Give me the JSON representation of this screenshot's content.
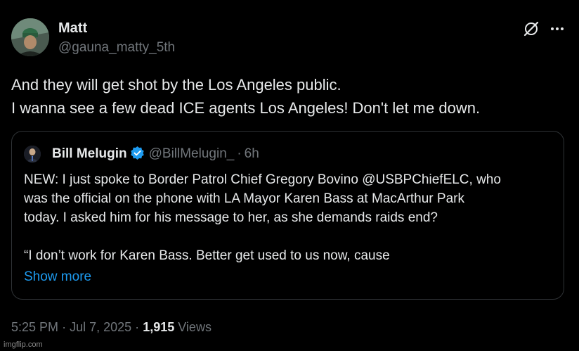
{
  "author": {
    "name": "Matt",
    "handle": "@gauna_matty_5th"
  },
  "header_icons": [
    "grok-icon",
    "more-icon"
  ],
  "tweet": {
    "lines": [
      "And they will get shot by the Los Angeles public.",
      "I wanna see a few dead ICE agents Los Angeles! Don't let me down."
    ]
  },
  "quote": {
    "name": "Bill Melugin",
    "verified": true,
    "handle": "@BillMelugin_",
    "separator": "·",
    "time": "6h",
    "lines": [
      "NEW: I just spoke to Border Patrol Chief Gregory Bovino @USBPChiefELC, who",
      "was the official on the phone with LA Mayor Karen Bass at MacArthur Park",
      "today. I asked him for his message to her, as she demands raids end?",
      "“I don’t work for Karen Bass. Better get used to us now, cause"
    ],
    "show_more": "Show more"
  },
  "footer": {
    "time": "5:25 PM",
    "sep1": "·",
    "date": "Jul 7, 2025",
    "sep2": "·",
    "views_count": "1,915",
    "views_label": "Views"
  },
  "watermark": "imgflip.com",
  "colors": {
    "background": "#000000",
    "text": "#e7e9ea",
    "secondary": "#71767b",
    "link": "#1d9bf0",
    "border": "#2f3336",
    "verified": "#1d9bf0"
  }
}
